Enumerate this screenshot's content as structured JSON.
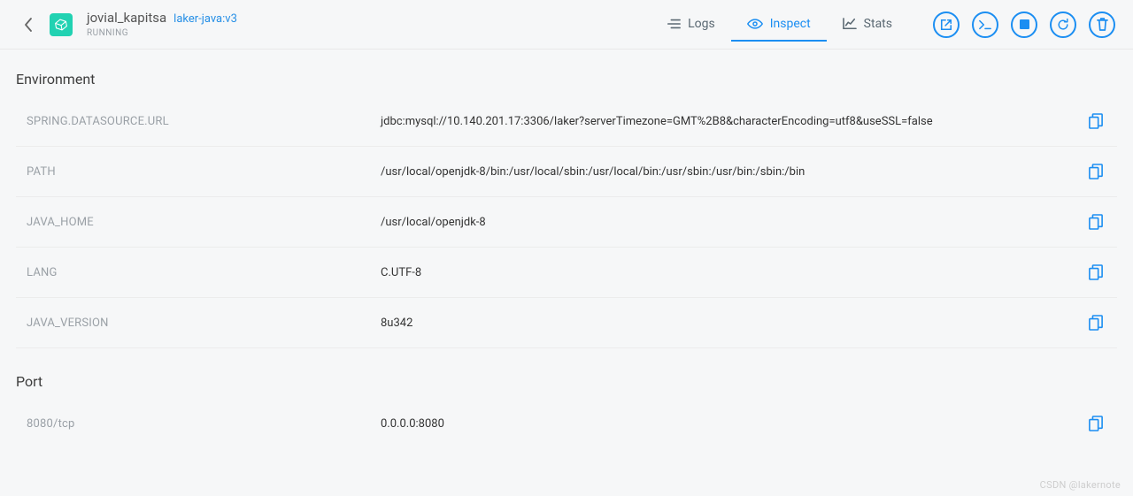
{
  "header": {
    "container_name": "jovial_kapitsa",
    "image": "laker-java:v3",
    "status": "RUNNING"
  },
  "tabs": {
    "logs": "Logs",
    "inspect": "Inspect",
    "stats": "Stats"
  },
  "environment": {
    "title": "Environment",
    "rows": [
      {
        "key": "SPRING.DATASOURCE.URL",
        "value": "jdbc:mysql://10.140.201.17:3306/laker?serverTimezone=GMT%2B8&characterEncoding=utf8&useSSL=false"
      },
      {
        "key": "PATH",
        "value": "/usr/local/openjdk-8/bin:/usr/local/sbin:/usr/local/bin:/usr/sbin:/usr/bin:/sbin:/bin"
      },
      {
        "key": "JAVA_HOME",
        "value": "/usr/local/openjdk-8"
      },
      {
        "key": "LANG",
        "value": "C.UTF-8"
      },
      {
        "key": "JAVA_VERSION",
        "value": "8u342"
      }
    ]
  },
  "port": {
    "title": "Port",
    "rows": [
      {
        "key": "8080/tcp",
        "value": "0.0.0.0:8080"
      }
    ]
  },
  "watermark": "CSDN @lakernote"
}
